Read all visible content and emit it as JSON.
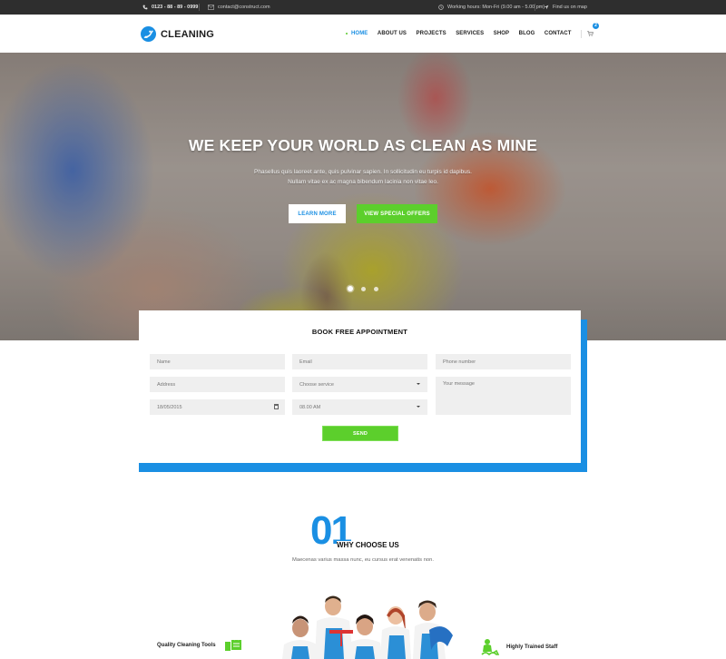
{
  "topbar": {
    "phone": "0123 - 88 - 89 - 0999",
    "email": "contact@construct.com",
    "hours": "Working hours: Mon-Fri (9.00 am - 5.00 pm)",
    "map": "Find us on map",
    "icons": [
      "phone-icon",
      "envelope-icon",
      "clock-icon",
      "location-arrow-icon"
    ]
  },
  "header": {
    "logo_text": "CLEANING",
    "nav": [
      {
        "label": "HOME",
        "active": true
      },
      {
        "label": "ABOUT US"
      },
      {
        "label": "PROJECTS"
      },
      {
        "label": "SERVICES"
      },
      {
        "label": "SHOP"
      },
      {
        "label": "BLOG"
      },
      {
        "label": "CONTACT"
      }
    ],
    "cart_count": "2"
  },
  "hero": {
    "title": "WE KEEP YOUR WORLD AS CLEAN AS MINE",
    "subtitle_line1": "Phasellus quis laoreet ante, quis pulvinar sapien. In sollicitudin eu turpis id dapibus.",
    "subtitle_line2": "Nullam vitae ex ac magna bibendum lacinia non vitae leo.",
    "learn_more": "LEARN MORE",
    "special_offers": "VIEW SPECIAL OFFERS",
    "slides": 3,
    "active_slide": 1
  },
  "booking": {
    "title": "BOOK FREE APPOINTMENT",
    "name_placeholder": "Name",
    "email_placeholder": "Email",
    "phone_placeholder": "Phone number",
    "address_placeholder": "Address",
    "service_selected": "Choose service",
    "message_placeholder": "Your message",
    "date_value": "18/05/2015",
    "time_selected": "08.00 AM",
    "send_label": "SEND"
  },
  "why": {
    "number": "01",
    "title": "WHY CHOOSE US",
    "subtitle": "Maecenas varius massa nunc, eu cursus erat venenatis non.",
    "features": [
      {
        "label": "Quality Cleaning Tools",
        "icon": "cleaning-tools-icon"
      },
      {
        "label": "Highly Trained Staff",
        "icon": "trained-staff-icon"
      }
    ]
  },
  "colors": {
    "accent_blue": "#1a8fe3",
    "accent_green": "#5ccf2c",
    "topbar_bg": "#2e2e2e"
  }
}
